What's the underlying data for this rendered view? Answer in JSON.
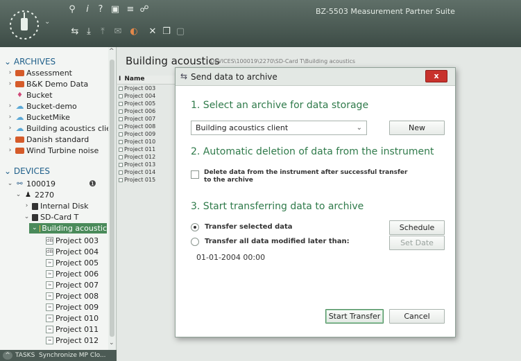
{
  "app": {
    "title": "BZ-5503 Measurement Partner Suite"
  },
  "toolbar": {
    "icons": [
      "search-icon",
      "info-icon",
      "help-icon",
      "table-icon",
      "signal-icon",
      "people-icon",
      "transfer-icon",
      "download-icon",
      "upload-icon",
      "email-icon",
      "palette-icon",
      "cut-icon",
      "copy-icon",
      "paste-icon"
    ]
  },
  "tree": {
    "archives_label": "ARCHIVES",
    "archives": [
      {
        "label": "Assessment",
        "icon": "archive-icon"
      },
      {
        "label": "B&K Demo Data",
        "icon": "archive-icon"
      },
      {
        "label": "Bucket",
        "icon": "bucket-icon"
      },
      {
        "label": "Bucket-demo",
        "icon": "cloud-icon"
      },
      {
        "label": "BucketMike",
        "icon": "cloud-icon"
      },
      {
        "label": "Building acoustics clier",
        "icon": "cloud-icon"
      },
      {
        "label": "Danish standard",
        "icon": "archive-icon"
      },
      {
        "label": "Wind Turbine noise",
        "icon": "archive-icon"
      }
    ],
    "devices_label": "DEVICES",
    "device_id": "100019",
    "instrument": "2270",
    "internal_disk": "Internal Disk",
    "sd_card": "SD-Card T",
    "selected_folder": "Building acoustic",
    "projects": [
      "Project 003",
      "Project 004",
      "Project 005",
      "Project 006",
      "Project 007",
      "Project 008",
      "Project 009",
      "Project 010",
      "Project 011",
      "Project 012"
    ]
  },
  "tasks": {
    "label": "TASKS",
    "text": "Synchronize MP Clo..."
  },
  "main": {
    "title": "Building acoustics",
    "path": "DEVICES\\100019\\2270\\SD-Card T\\Building acoustics",
    "list_col_i": "I",
    "list_col_name": "Name",
    "list_items": [
      "Project 003",
      "Project 004",
      "Project 005",
      "Project 006",
      "Project 007",
      "Project 008",
      "Project 009",
      "Project 010",
      "Project 011",
      "Project 012",
      "Project 013",
      "Project 014",
      "Project 015"
    ]
  },
  "dialog": {
    "title": "Send data to archive",
    "close": "x",
    "section1": "1. Select an archive for data storage",
    "archive_value": "Building acoustics client",
    "new_button": "New",
    "section2": "2. Automatic deletion of data from the instrument",
    "delete_label": "Delete data from the instrument after successful transfer to the archive",
    "delete_checked": false,
    "section3": "3. Start transferring data to archive",
    "radio_selected_label": "Transfer selected data",
    "radio_all_label": "Transfer all data modified later than:",
    "schedule_button": "Schedule",
    "set_date_button": "Set Date",
    "date_value": "01-01-2004 00:00",
    "start_button": "Start Transfer",
    "cancel_button": "Cancel"
  },
  "colors": {
    "accent_green": "#2f7a4a",
    "header_blue": "#1f5f8a",
    "close_red": "#c8322c",
    "selected_row": "#4a8a5a"
  }
}
